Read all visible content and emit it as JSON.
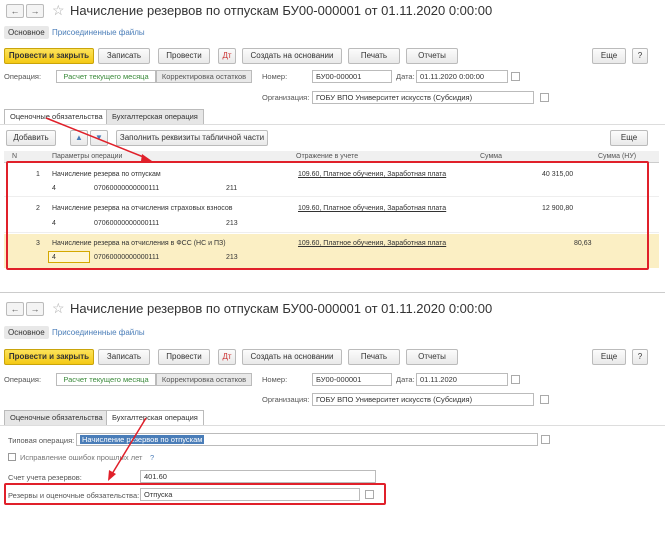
{
  "top": {
    "title": "Начисление резервов по отпускам БУ00-000001 от 01.11.2020 0:00:00",
    "tabs": [
      "Основное",
      "Присоединенные файлы"
    ],
    "toolbar": {
      "post_close": "Провести и закрыть",
      "save": "Записать",
      "post": "Провести",
      "create_based": "Создать на основании",
      "print": "Печать",
      "reports": "Отчеты",
      "more": "Еще"
    },
    "operation_label": "Операция:",
    "op_current": "Расчет текущего месяца",
    "op_adjust": "Корректировка остатков",
    "number_label": "Номер:",
    "number_value": "БУ00-000001",
    "date_label": "Дата:",
    "date_value": "01.11.2020 0:00:00",
    "org_label": "Организация:",
    "org_value": "ГОБУ ВПО Университет искусств (Субсидия)",
    "inner_tabs": [
      "Оценочные обязательства",
      "Бухгалтерская операция"
    ],
    "add_btn": "Добавить",
    "fill_btn": "Заполнить реквизиты табличной части",
    "more_btn": "Еще",
    "columns": [
      "N",
      "Параметры операции",
      "Отражение в учете",
      "Сумма",
      "Сумма (НУ)"
    ],
    "rows": [
      {
        "n": "1",
        "param": "Начисление резерва по отпускам",
        "account": "109.60, Платное обучения, Заработная плата",
        "sum": "40 315,00",
        "sub1": "4",
        "sub2": "07060000000000111",
        "sub3": "211"
      },
      {
        "n": "2",
        "param": "Начисление резерва на отчисления страховых взносов",
        "account": "109.60, Платное обучения, Заработная плата",
        "sum": "12 900,80",
        "sub1": "4",
        "sub2": "07060000000000111",
        "sub3": "213"
      },
      {
        "n": "3",
        "param": "Начисление резерва на отчисления в ФСС (НС и ПЗ)",
        "account": "109.60, Платное обучения, Заработная плата",
        "sum": "80,63",
        "sub1": "4",
        "sub2": "07060000000000111",
        "sub3": "213"
      }
    ]
  },
  "bottom": {
    "title": "Начисление резервов по отпускам БУ00-000001 от 01.11.2020 0:00:00",
    "tabs": [
      "Основное",
      "Присоединенные файлы"
    ],
    "toolbar": {
      "post_close": "Провести и закрыть",
      "save": "Записать",
      "post": "Провести",
      "create_based": "Создать на основании",
      "print": "Печать",
      "reports": "Отчеты",
      "more": "Еще"
    },
    "operation_label": "Операция:",
    "op_current": "Расчет текущего месяца",
    "op_adjust": "Корректировка остатков",
    "number_label": "Номер:",
    "number_value": "БУ00-000001",
    "date_label": "Дата:",
    "date_value": "01.11.2020",
    "org_label": "Организация:",
    "org_value": "ГОБУ ВПО Университет искусств (Субсидия)",
    "inner_tabs": [
      "Оценочные обязательства",
      "Бухгалтерская операция"
    ],
    "typical_op_label": "Типовая операция:",
    "typical_op_value": "Начисление резервов по отпускам",
    "fix_errors_label": "Исправление ошибок прошлых лет",
    "help_mark": "?",
    "account_label": "Счет учета резервов:",
    "account_value": "401.60",
    "reserves_label": "Резервы и оценочные обязательства:",
    "reserves_value": "Отпуска"
  },
  "colors": {
    "accent": "#f4c915",
    "highlight": "#e0202a",
    "link": "#4a7db8",
    "selected_row": "#fbefc4"
  }
}
